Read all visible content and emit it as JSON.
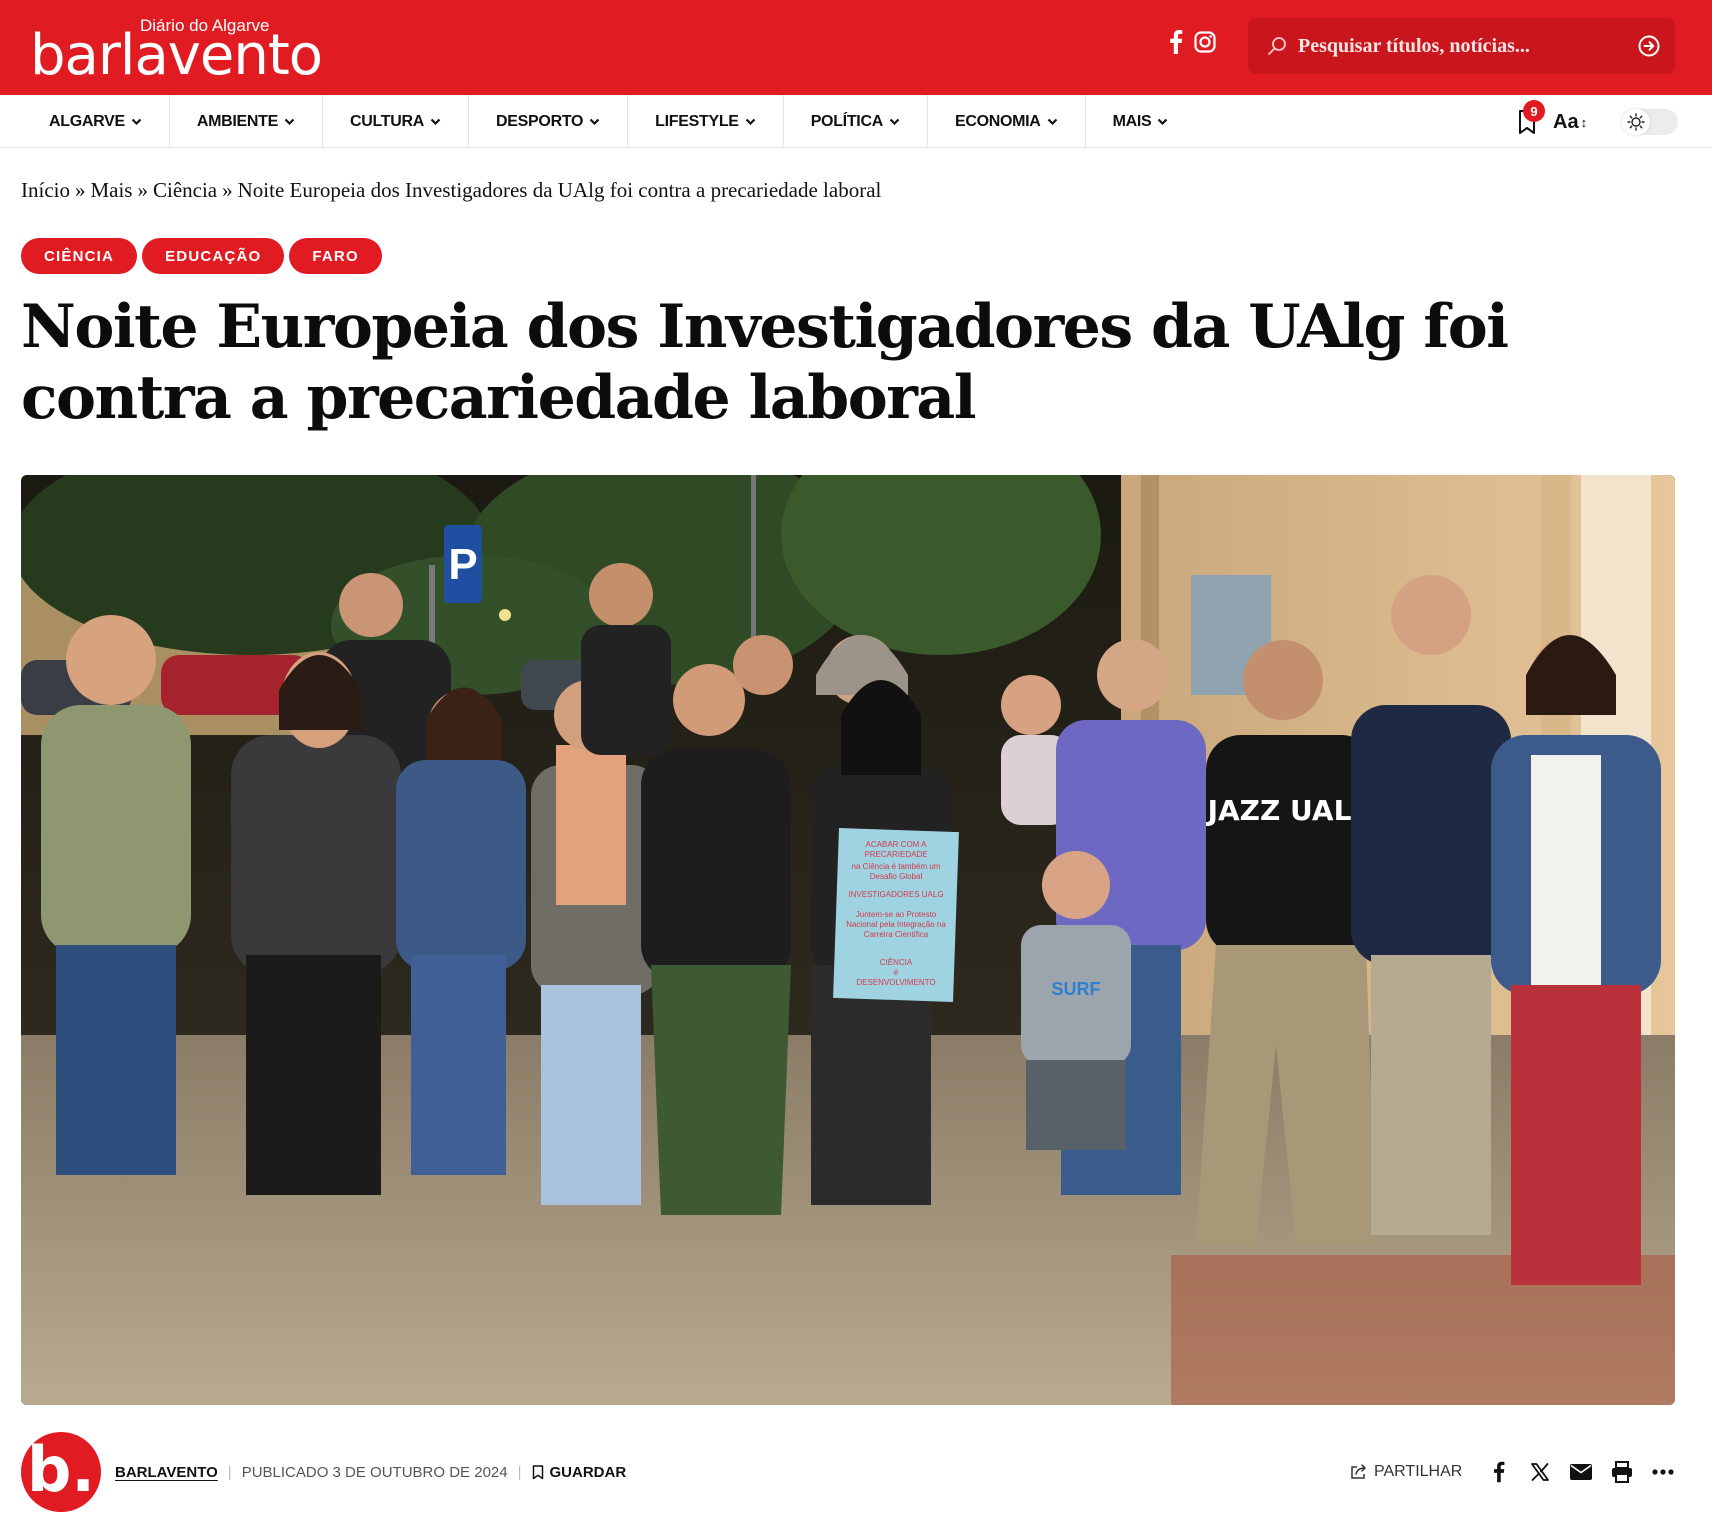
{
  "colors": {
    "brand_red": "#e11b22"
  },
  "header": {
    "logo_tagline": "Diário do Algarve",
    "logo_wordmark": "barlavento",
    "social": [
      "facebook-icon",
      "instagram-icon"
    ],
    "search_placeholder": "Pesquisar títulos, notícias..."
  },
  "nav": {
    "items": [
      {
        "label": "ALGARVE"
      },
      {
        "label": "AMBIENTE"
      },
      {
        "label": "CULTURA"
      },
      {
        "label": "DESPORTO"
      },
      {
        "label": "LIFESTYLE"
      },
      {
        "label": "POLÍTICA"
      },
      {
        "label": "ECONOMIA"
      },
      {
        "label": "MAIS"
      }
    ],
    "bookmark_count": "9",
    "font_size_label": "Aa",
    "font_size_arrow": "↕"
  },
  "breadcrumb": {
    "items": [
      "Início",
      "»",
      "Mais",
      "»",
      "Ciência",
      "»",
      "Noite Europeia dos Investigadores da UAlg foi contra a precariedade laboral"
    ]
  },
  "article": {
    "tags": [
      "CIÊNCIA",
      "EDUCAÇÃO",
      "FARO"
    ],
    "title": "Noite Europeia dos Investigadores da UAlg foi contra a precariedade laboral",
    "avatar_letter": "b.",
    "author": "BARLAVENTO",
    "published": "PUBLICADO 3 DE OUTUBRO DE 2024",
    "save_label": "GUARDAR",
    "share_label": "PARTILHAR",
    "share_icons": [
      "facebook-icon",
      "x-icon",
      "email-icon",
      "print-icon",
      "more-icon"
    ]
  },
  "hero": {
    "sign_lines": [
      "ACABAR COM A",
      "PRECARIEDADE",
      "na Ciência é também um",
      "Desafio Global",
      "INVESTIGADORES UALG",
      "Juntem-se ao Protesto",
      "Nacional pela Integração na",
      "Carreira Científica",
      "CIÊNCIA",
      "é",
      "DESENVOLVIMENTO"
    ],
    "parking_sign": "P",
    "shirt_text": "JAZZ UALG",
    "kid_shirt": "SURF"
  }
}
